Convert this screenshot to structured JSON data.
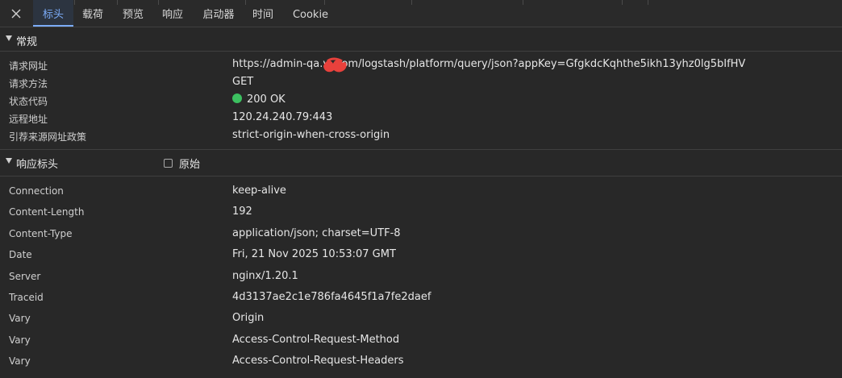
{
  "tabs": [
    {
      "label": "标头",
      "active": true
    },
    {
      "label": "载荷",
      "active": false
    },
    {
      "label": "预览",
      "active": false
    },
    {
      "label": "响应",
      "active": false
    },
    {
      "label": "启动器",
      "active": false
    },
    {
      "label": "时间",
      "active": false
    },
    {
      "label": "Cookie",
      "active": false
    }
  ],
  "general": {
    "title": "常规",
    "rows": [
      {
        "name": "请求网址",
        "value": "https://admin-qa.v       .com/logstash/platform/query/json?appKey=GfgkdcKqhthe5ikh13yhz0lg5bIfHV"
      },
      {
        "name": "请求方法",
        "value": "GET"
      },
      {
        "name": "状态代码",
        "value": "200 OK"
      },
      {
        "name": "远程地址",
        "value": "120.24.240.79:443"
      },
      {
        "name": "引荐来源网址政策",
        "value": "strict-origin-when-cross-origin"
      }
    ]
  },
  "response_headers": {
    "title": "响应标头",
    "raw_label": "原始",
    "raw_checked": false,
    "rows": [
      {
        "name": "Connection",
        "value": "keep-alive"
      },
      {
        "name": "Content-Length",
        "value": "192"
      },
      {
        "name": "Content-Type",
        "value": "application/json; charset=UTF-8"
      },
      {
        "name": "Date",
        "value": "Fri, 21 Nov 2025 10:53:07 GMT"
      },
      {
        "name": "Server",
        "value": "nginx/1.20.1"
      },
      {
        "name": "Traceid",
        "value": "4d3137ae2c1e786fa4645f1a7fe2daef"
      },
      {
        "name": "Vary",
        "value": "Origin"
      },
      {
        "name": "Vary",
        "value": "Access-Control-Request-Method"
      },
      {
        "name": "Vary",
        "value": "Access-Control-Request-Headers"
      }
    ]
  },
  "icons": {
    "close": "close-icon",
    "expand": "triangle-down-icon",
    "status": "status-dot-icon"
  },
  "colors": {
    "accent": "#7cacf8",
    "status_ok": "#3cc060",
    "redaction": "#e8413c"
  }
}
